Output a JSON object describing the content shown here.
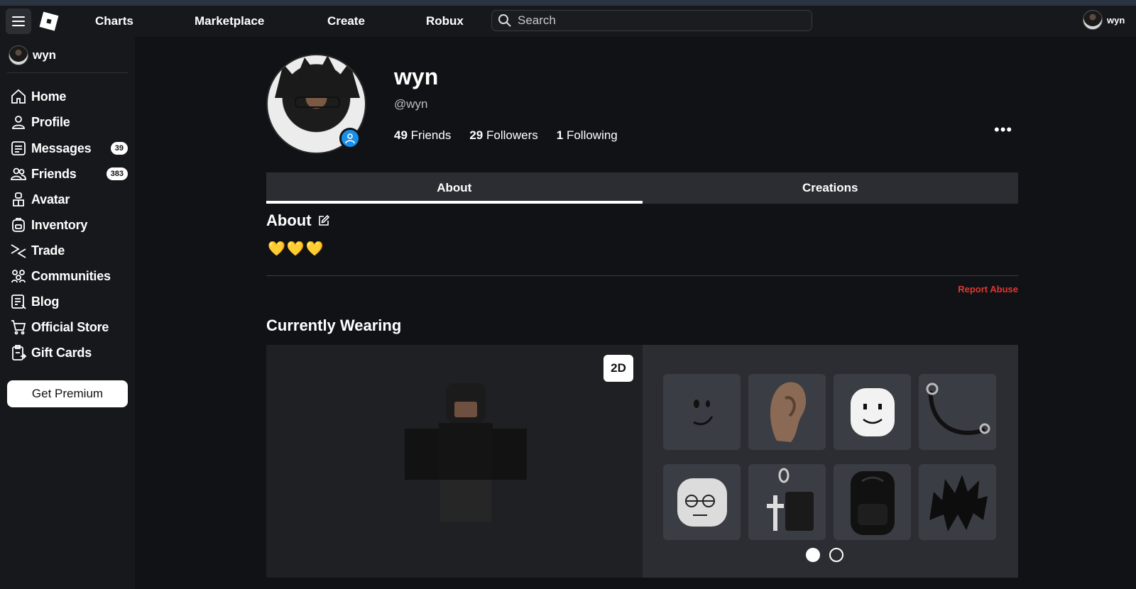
{
  "topbar": {
    "nav": [
      "Charts",
      "Marketplace",
      "Create",
      "Robux"
    ],
    "search_placeholder": "Search",
    "user_name": "wyn"
  },
  "sidebar": {
    "user_name": "wyn",
    "items": [
      {
        "label": "Home",
        "icon": "home-icon"
      },
      {
        "label": "Profile",
        "icon": "profile-icon"
      },
      {
        "label": "Messages",
        "icon": "messages-icon",
        "badge": "39"
      },
      {
        "label": "Friends",
        "icon": "friends-icon",
        "badge": "383"
      },
      {
        "label": "Avatar",
        "icon": "avatar-icon"
      },
      {
        "label": "Inventory",
        "icon": "inventory-icon"
      },
      {
        "label": "Trade",
        "icon": "trade-icon"
      },
      {
        "label": "Communities",
        "icon": "communities-icon"
      },
      {
        "label": "Blog",
        "icon": "blog-icon"
      },
      {
        "label": "Official Store",
        "icon": "store-icon"
      },
      {
        "label": "Gift Cards",
        "icon": "gift-card-icon"
      }
    ],
    "premium_label": "Get Premium"
  },
  "profile": {
    "display_name": "wyn",
    "handle": "@wyn",
    "friends_count": "49",
    "friends_label": "Friends",
    "followers_count": "29",
    "followers_label": "Followers",
    "following_count": "1",
    "following_label": "Following",
    "more_label": "•••"
  },
  "tabs": [
    "About",
    "Creations"
  ],
  "about": {
    "title": "About",
    "text": "💛💛💛",
    "report_label": "Report Abuse"
  },
  "wearing": {
    "title": "Currently Wearing",
    "toggle_label": "2D",
    "items": [
      "smile-face-item",
      "ear-item",
      "smile-head-item",
      "chain-strap-item",
      "sleepy-head-item",
      "cross-keychain-item",
      "black-backpack-item",
      "black-hair-item"
    ],
    "pages": 2,
    "current_page": 1
  },
  "colors": {
    "background": "#111216",
    "panel": "#17181c",
    "tab_bar": "#2b2d32",
    "report": "#e0382f",
    "status": "#1a8fe8"
  }
}
